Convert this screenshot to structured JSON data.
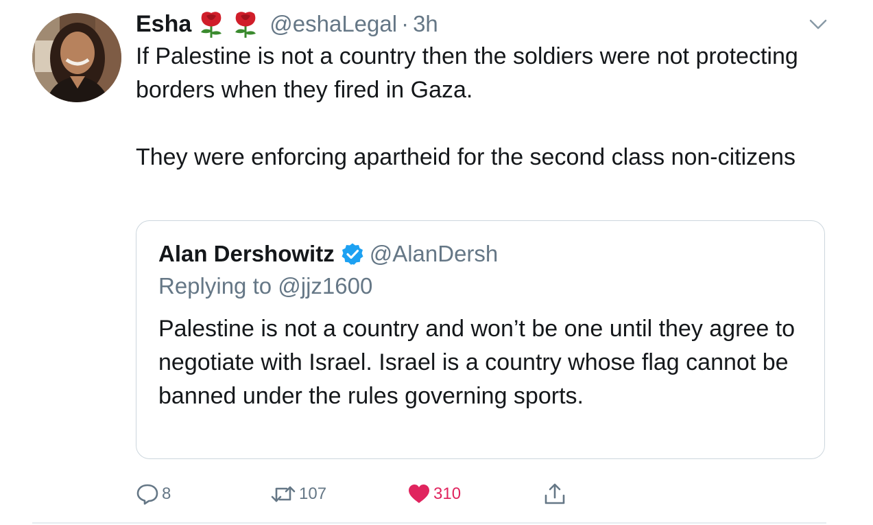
{
  "tweet": {
    "display_name": "Esha",
    "handle": "@eshaLegal",
    "separator": "·",
    "time": "3h",
    "paragraphs": [
      "If Palestine is not a country then the soldiers were not protecting borders when they fired in Gaza.",
      "They were enforcing apartheid for the second class non-citizens"
    ],
    "name_emoji": [
      "rose-emoji",
      "rose-emoji"
    ]
  },
  "quoted": {
    "display_name": "Alan Dershowitz",
    "handle": "@AlanDersh",
    "replying_to": "Replying to @jjz1600",
    "text": "Palestine is not a country and won’t be one until they agree to negotiate with Israel. Israel is a country whose flag cannot be banned under the rules governing sports.",
    "verified": true
  },
  "actions": {
    "reply_count": "8",
    "retweet_count": "107",
    "like_count": "310",
    "like_active": true
  },
  "colors": {
    "primary_text": "#14171a",
    "secondary_text": "#657786",
    "like": "#e0245e",
    "verified": "#1da1f2",
    "border": "#ccd6dd"
  }
}
